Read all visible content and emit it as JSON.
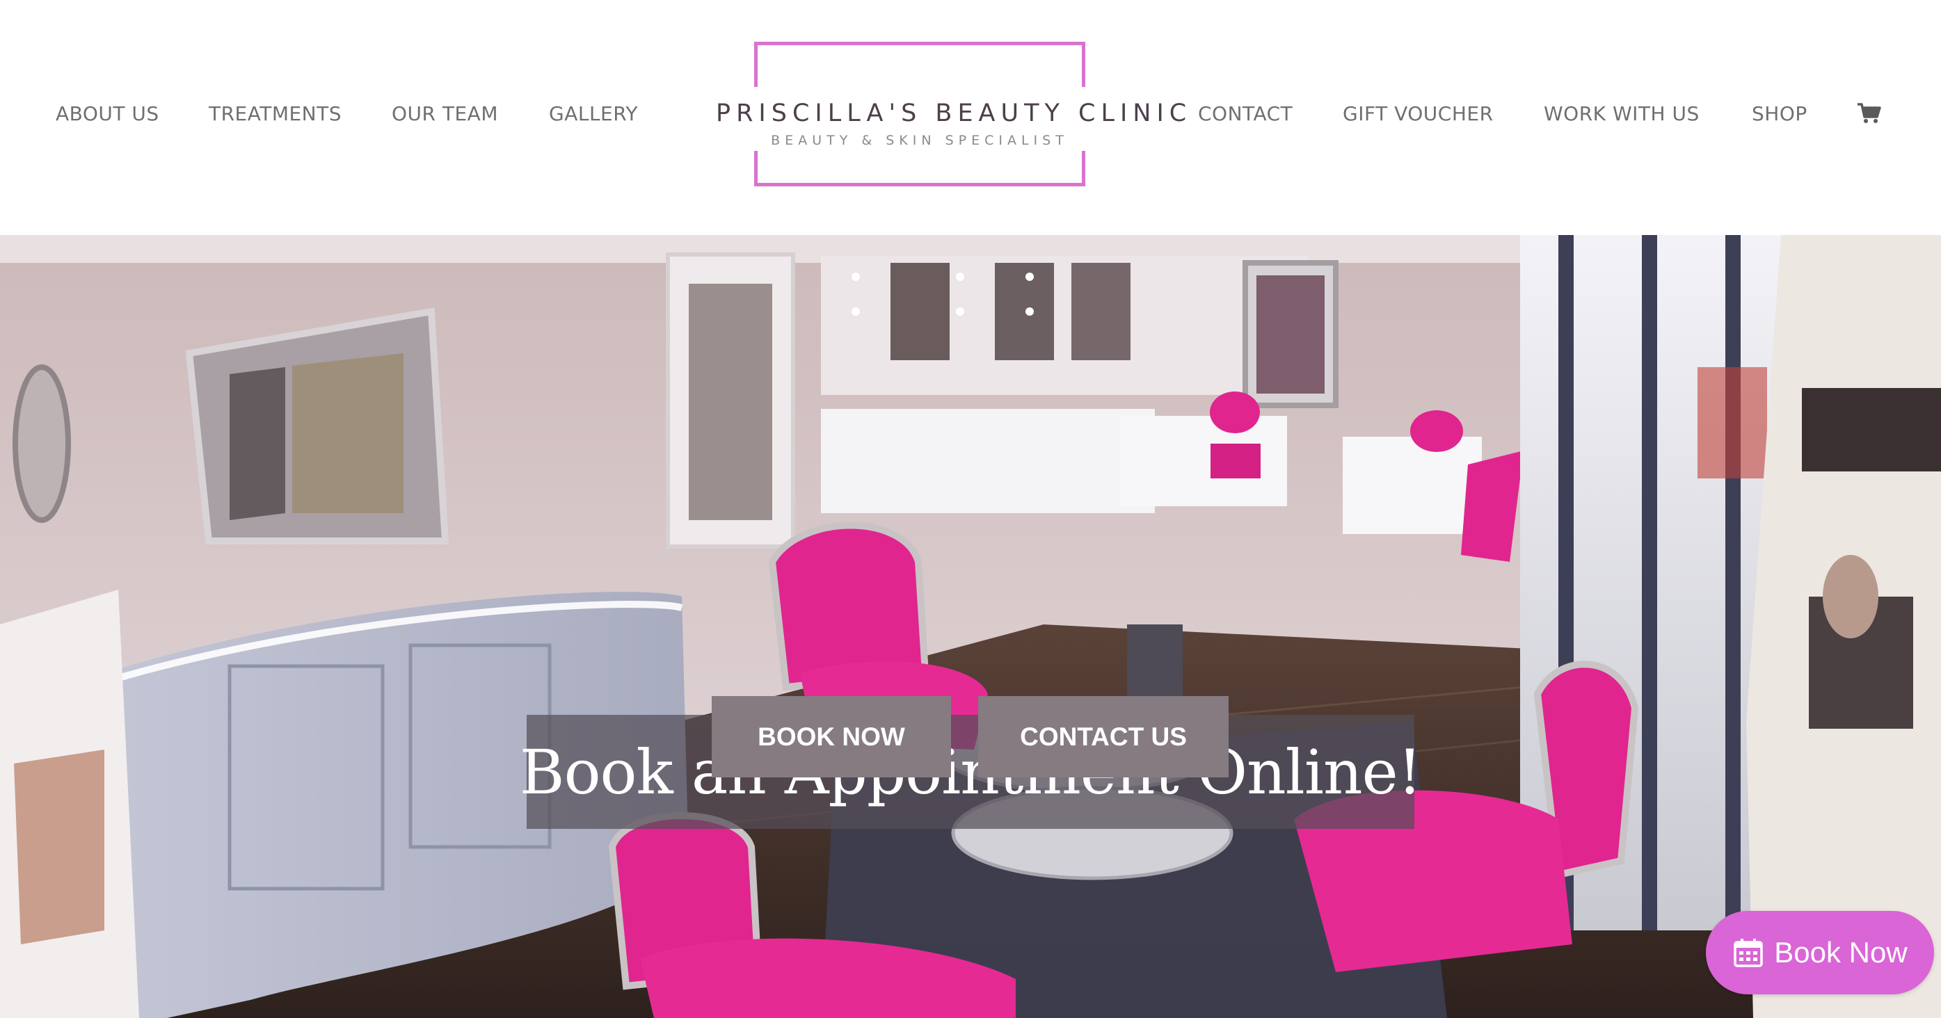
{
  "nav": {
    "left": [
      "ABOUT US",
      "TREATMENTS",
      "OUR TEAM",
      "GALLERY"
    ],
    "right": [
      "CONTACT",
      "GIFT VOUCHER",
      "WORK WITH US",
      "SHOP"
    ],
    "cart_icon": "shopping-cart-icon"
  },
  "logo": {
    "title": "PRISCILLA'S BEAUTY CLINIC",
    "subtitle": "BEAUTY & SKIN SPECIALIST",
    "border_color": "#d873d0"
  },
  "hero": {
    "headline": "Book an Appointment Online!",
    "book_now_label": "BOOK NOW",
    "contact_us_label": "CONTACT US"
  },
  "floating_button": {
    "label": "Book Now",
    "icon": "calendar-icon",
    "color": "#d965d6"
  },
  "colors": {
    "accent_pink": "#e0258f",
    "nav_text": "#6f6f6f",
    "button_bg": "#857b81"
  }
}
